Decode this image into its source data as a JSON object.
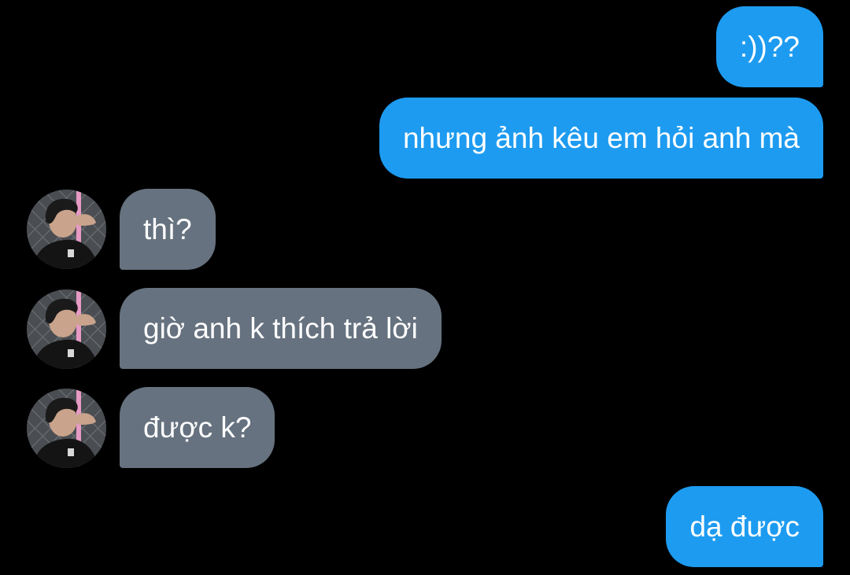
{
  "conversation": {
    "messages": [
      {
        "direction": "sent",
        "text": ":))??"
      },
      {
        "direction": "sent",
        "text": "nhưng ảnh kêu em hỏi anh mà"
      },
      {
        "direction": "received",
        "text": "thì?"
      },
      {
        "direction": "received",
        "text": "giờ anh k thích trả lời"
      },
      {
        "direction": "received",
        "text": "được k?"
      },
      {
        "direction": "sent",
        "text": "dạ được"
      }
    ]
  },
  "colors": {
    "background": "#000000",
    "sent_bubble": "#1d9bf0",
    "received_bubble": "#66727f",
    "text": "#ffffff"
  },
  "icons": {
    "avatar": "profile-photo-avatar"
  }
}
